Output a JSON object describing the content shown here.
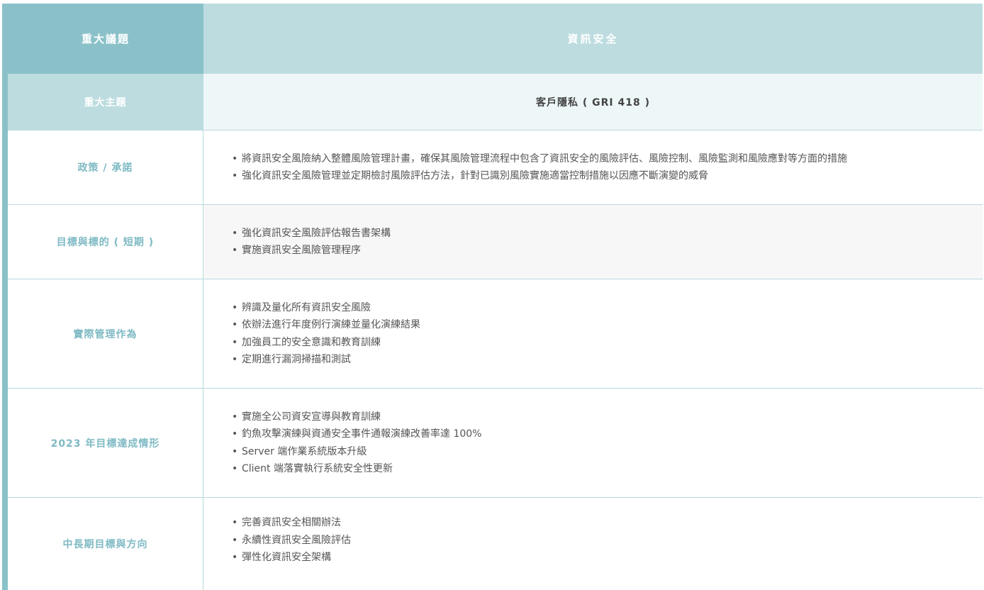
{
  "header": {
    "label": "重大議題",
    "value": "資訊安全"
  },
  "topic": {
    "label": "重大主題",
    "value": "客戶隱私 ( GRI 418 )"
  },
  "rows": [
    {
      "label": "政策 / 承諾",
      "items": [
        "將資訊安全風險納入整體風險管理計畫，確保其風險管理流程中包含了資訊安全的風險評估、風險控制、風險監測和風險應對等方面的措施",
        "強化資訊安全風險管理並定期檢討風險評估方法，針對已識別風險實施適當控制措施以因應不斷演變的威脅"
      ]
    },
    {
      "label": "目標與標的 ( 短期 )",
      "items": [
        "強化資訊安全風險評估報告書架構",
        "實施資訊安全風險管理程序"
      ]
    },
    {
      "label": "實際管理作為",
      "items": [
        "辨識及量化所有資訊安全風險",
        "依辦法進行年度例行演練並量化演練結果",
        "加強員工的安全意識和教育訓練",
        "定期進行漏洞掃描和測試"
      ]
    },
    {
      "label": "2023 年目標達成情形",
      "items": [
        "實施全公司資安宣導與教育訓練",
        "釣魚攻擊演練與資通安全事件通報演練改善率達 100%",
        "Server 端作業系統版本升級",
        "Client 端落實執行系統安全性更新"
      ]
    },
    {
      "label": "中長期目標與方向",
      "items": [
        "完善資訊安全相關辦法",
        "永續性資訊安全風險評估",
        "彈性化資訊安全架構"
      ]
    }
  ]
}
